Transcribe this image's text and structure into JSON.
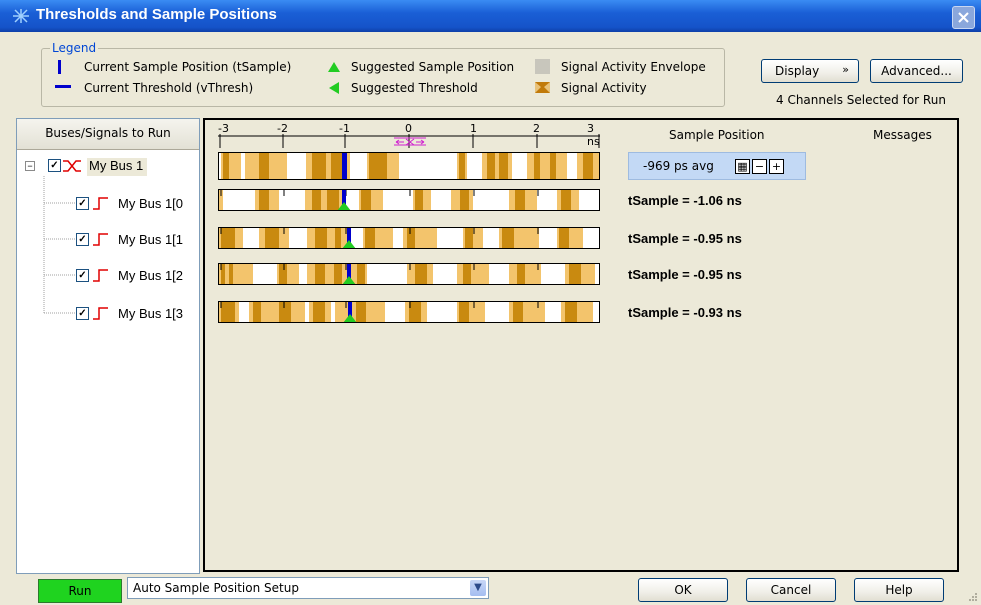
{
  "window": {
    "title": "Thresholds and Sample Positions"
  },
  "legend": {
    "title": "Legend",
    "items": [
      {
        "label": "Current Sample Position (tSample)",
        "icon": "vertical-blue-bar-icon"
      },
      {
        "label": "Current Threshold (vThresh)",
        "icon": "horizontal-blue-bar-icon"
      },
      {
        "label": "Suggested Sample Position",
        "icon": "green-up-triangle-icon"
      },
      {
        "label": "Suggested Threshold",
        "icon": "green-left-triangle-icon"
      },
      {
        "label": "Signal Activity Envelope",
        "icon": "gray-square-icon"
      },
      {
        "label": "Signal Activity",
        "icon": "gold-hourglass-icon"
      }
    ]
  },
  "toolbar": {
    "display_label": "Display",
    "advanced_label": "Advanced...",
    "channels_selected": "4 Channels Selected for Run"
  },
  "tree": {
    "header": "Buses/Signals to Run",
    "bus": {
      "label": "My Bus 1",
      "expander": "−"
    },
    "signals": [
      {
        "label": "My Bus 1[0"
      },
      {
        "label": "My Bus 1[1"
      },
      {
        "label": "My Bus 1[2"
      },
      {
        "label": "My Bus 1[3"
      }
    ]
  },
  "scale": {
    "ticks": [
      "-3",
      "-2",
      "-1",
      "0",
      "1",
      "2",
      "3 ns"
    ]
  },
  "columns": {
    "sample_position": "Sample Position",
    "messages": "Messages"
  },
  "sample": {
    "avg_value": "-969 ps avg",
    "minus": "−",
    "plus": "+"
  },
  "rows": [
    {
      "tsample": "tSample = -1.06 ns"
    },
    {
      "tsample": "tSample = -0.95 ns"
    },
    {
      "tsample": "tSample = -0.95 ns"
    },
    {
      "tsample": "tSample = -0.93 ns"
    }
  ],
  "colors": {
    "activity": "#d49a1a",
    "envelope": "#f5cd7e",
    "marker": "#0000cc",
    "suggested": "#22cc22",
    "run_button": "#1fd31f"
  },
  "bottom": {
    "run_label": "Run",
    "setup_value": "Auto Sample Position Setup",
    "ok_label": "OK",
    "cancel_label": "Cancel",
    "help_label": "Help"
  }
}
